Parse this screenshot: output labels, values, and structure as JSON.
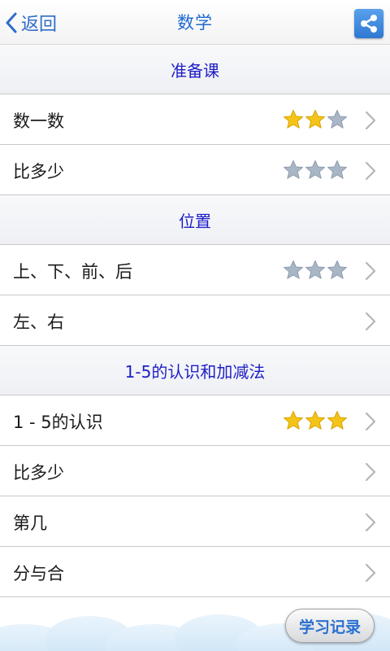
{
  "header": {
    "back_label": "返回",
    "title": "数学",
    "share_icon": "share-icon"
  },
  "sections": [
    {
      "title": "准备课",
      "items": [
        {
          "label": "数一数",
          "stars": 2,
          "max_stars": 3
        },
        {
          "label": "比多少",
          "stars": 0,
          "max_stars": 3
        }
      ]
    },
    {
      "title": "位置",
      "items": [
        {
          "label": "上、下、前、后",
          "stars": 0,
          "max_stars": 3
        },
        {
          "label": "左、右",
          "stars": null,
          "max_stars": null
        }
      ]
    },
    {
      "title": "1-5的认识和加减法",
      "items": [
        {
          "label": "1 - 5的认识",
          "stars": 3,
          "max_stars": 3
        },
        {
          "label": "比多少",
          "stars": null,
          "max_stars": null
        },
        {
          "label": "第几",
          "stars": null,
          "max_stars": null
        },
        {
          "label": "分与合",
          "stars": null,
          "max_stars": null
        }
      ]
    }
  ],
  "footer": {
    "record_button_label": "学习记录"
  },
  "colors": {
    "accent": "#2f6cc8",
    "section_text": "#1e1ec8",
    "star_filled": "#f4c419",
    "star_empty": "#a9b6c6"
  }
}
